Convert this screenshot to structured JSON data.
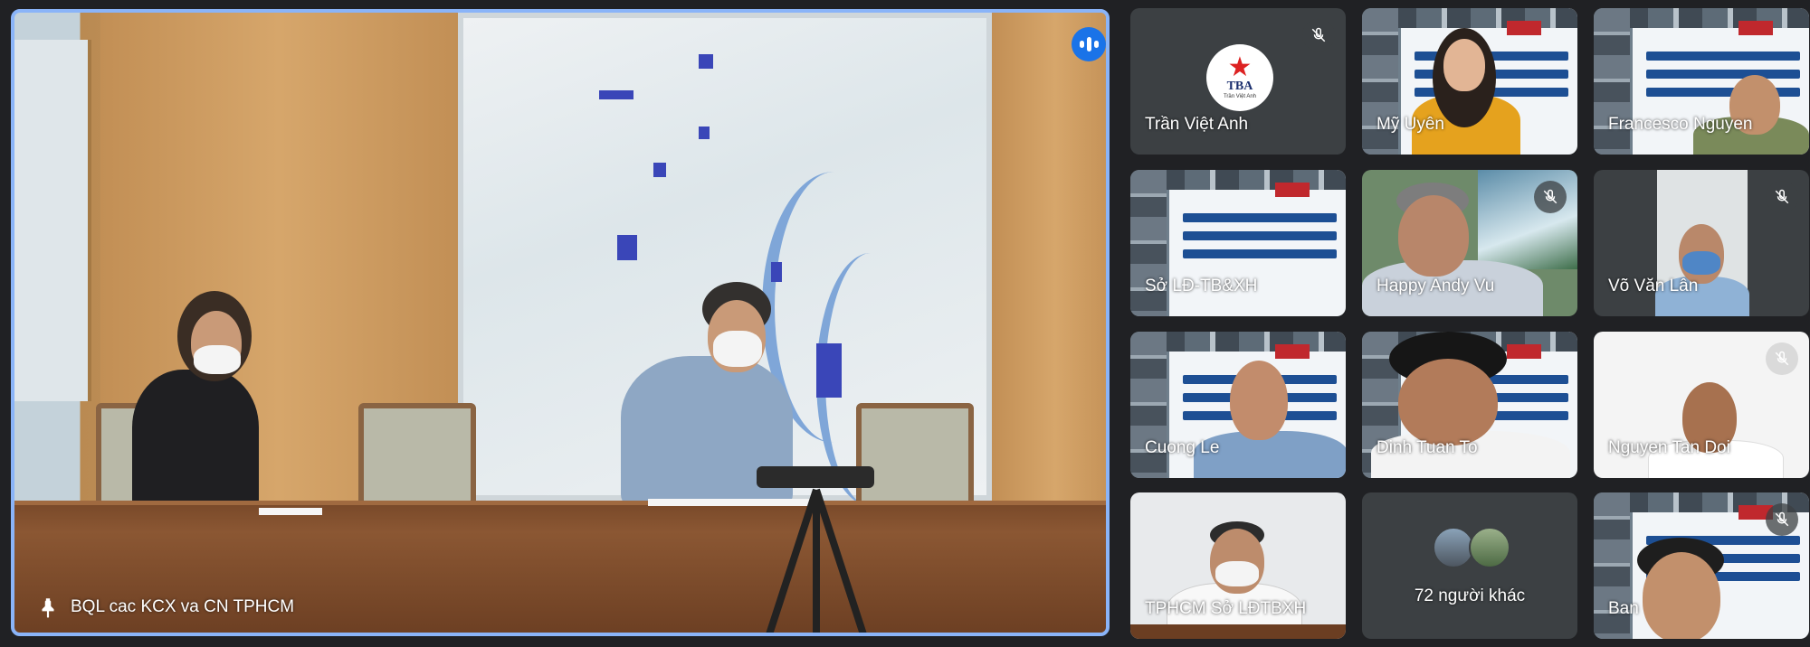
{
  "main": {
    "participant_name": "BQL cac KCX va CN TPHCM",
    "speaking": true,
    "pinned": true
  },
  "grid": [
    {
      "name": "Trần Việt Anh",
      "muted": true,
      "kind": "logo",
      "logo_text": "TBA",
      "logo_subtext": "Trần Việt Anh"
    },
    {
      "name": "Mỹ Uyên",
      "muted": false,
      "kind": "banner-person"
    },
    {
      "name": "Francesco Nguyen",
      "muted": false,
      "kind": "banner-person"
    },
    {
      "name": "Sở LĐ-TB&XH",
      "muted": false,
      "kind": "banner"
    },
    {
      "name": "Happy Andy Vu",
      "muted": true,
      "kind": "person"
    },
    {
      "name": "Võ Văn Lân",
      "muted": true,
      "kind": "person"
    },
    {
      "name": "Cuong Le",
      "muted": false,
      "kind": "banner-person"
    },
    {
      "name": "Dinh Tuan To",
      "muted": false,
      "kind": "banner-person"
    },
    {
      "name": "Nguyen Tan Doi",
      "muted": true,
      "kind": "person"
    },
    {
      "name": "TPHCM Sở LĐTBXH",
      "muted": false,
      "kind": "person"
    },
    {
      "name": "72 người khác",
      "muted": false,
      "kind": "others"
    },
    {
      "name": "Ban",
      "muted": true,
      "kind": "banner-person"
    }
  ],
  "colors": {
    "background": "#202124",
    "tile": "#3c4043",
    "active_border": "#8ab4f8",
    "speaking_badge": "#1a73e8"
  },
  "icons": {
    "pin": "pin-icon",
    "speaking": "speaking-indicator-icon",
    "mic_off": "mic-off-icon"
  }
}
